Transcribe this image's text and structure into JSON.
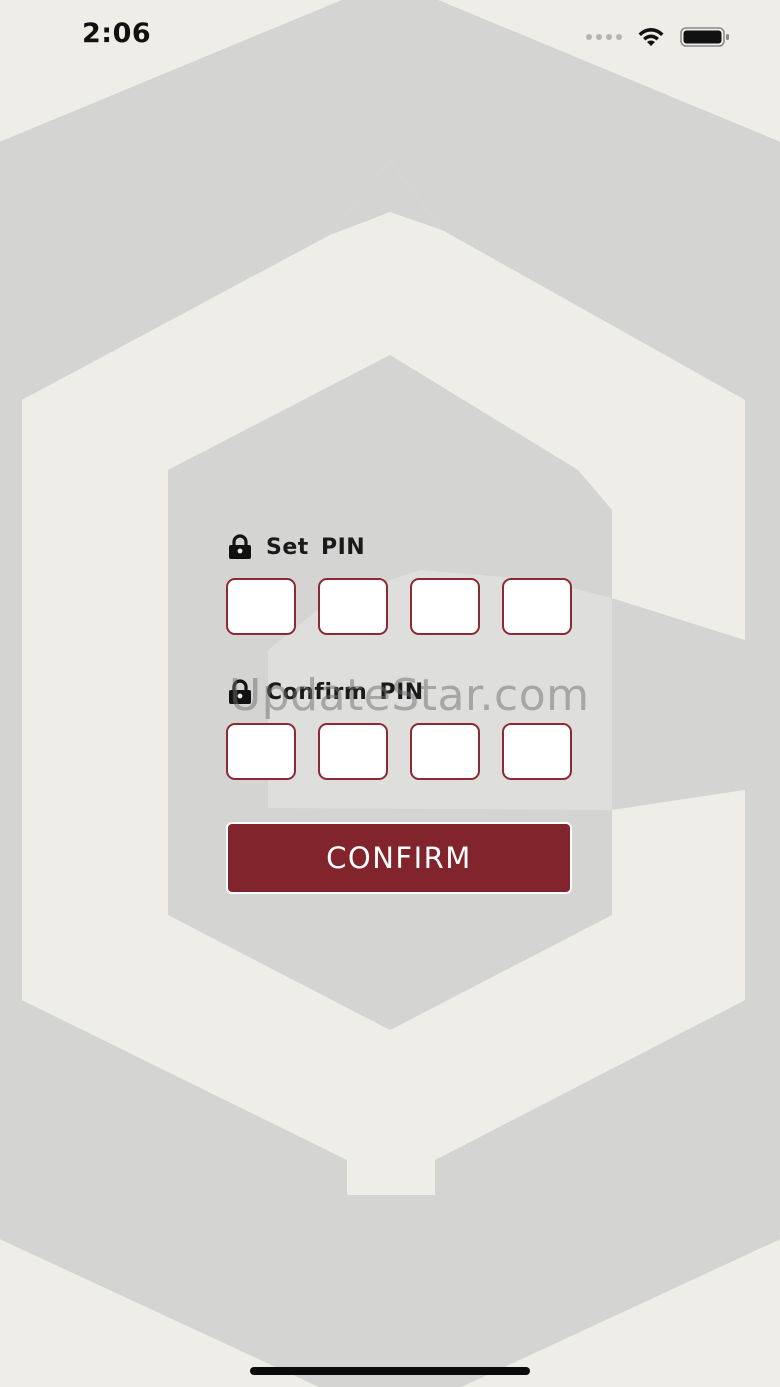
{
  "status_bar": {
    "time": "2:06",
    "signal_icon": "cellular-signal-icon",
    "wifi_icon": "wifi-icon",
    "battery_icon": "battery-icon"
  },
  "background": {
    "logo_icon": "hexagon-g-logo",
    "colors": {
      "base": "#efede7",
      "logo": "#d2d2d0"
    }
  },
  "form": {
    "set_pin": {
      "icon": "lock-icon",
      "label": "Set PIN",
      "digits": [
        "",
        "",
        "",
        ""
      ]
    },
    "confirm_pin": {
      "icon": "lock-icon",
      "label": "Confirm PIN",
      "digits": [
        "",
        "",
        "",
        ""
      ]
    },
    "confirm_button_label": "CONFIRM",
    "colors": {
      "accent": "#82242c",
      "pin_border": "#8b2a33"
    }
  },
  "watermark": "UpdateStar.com"
}
